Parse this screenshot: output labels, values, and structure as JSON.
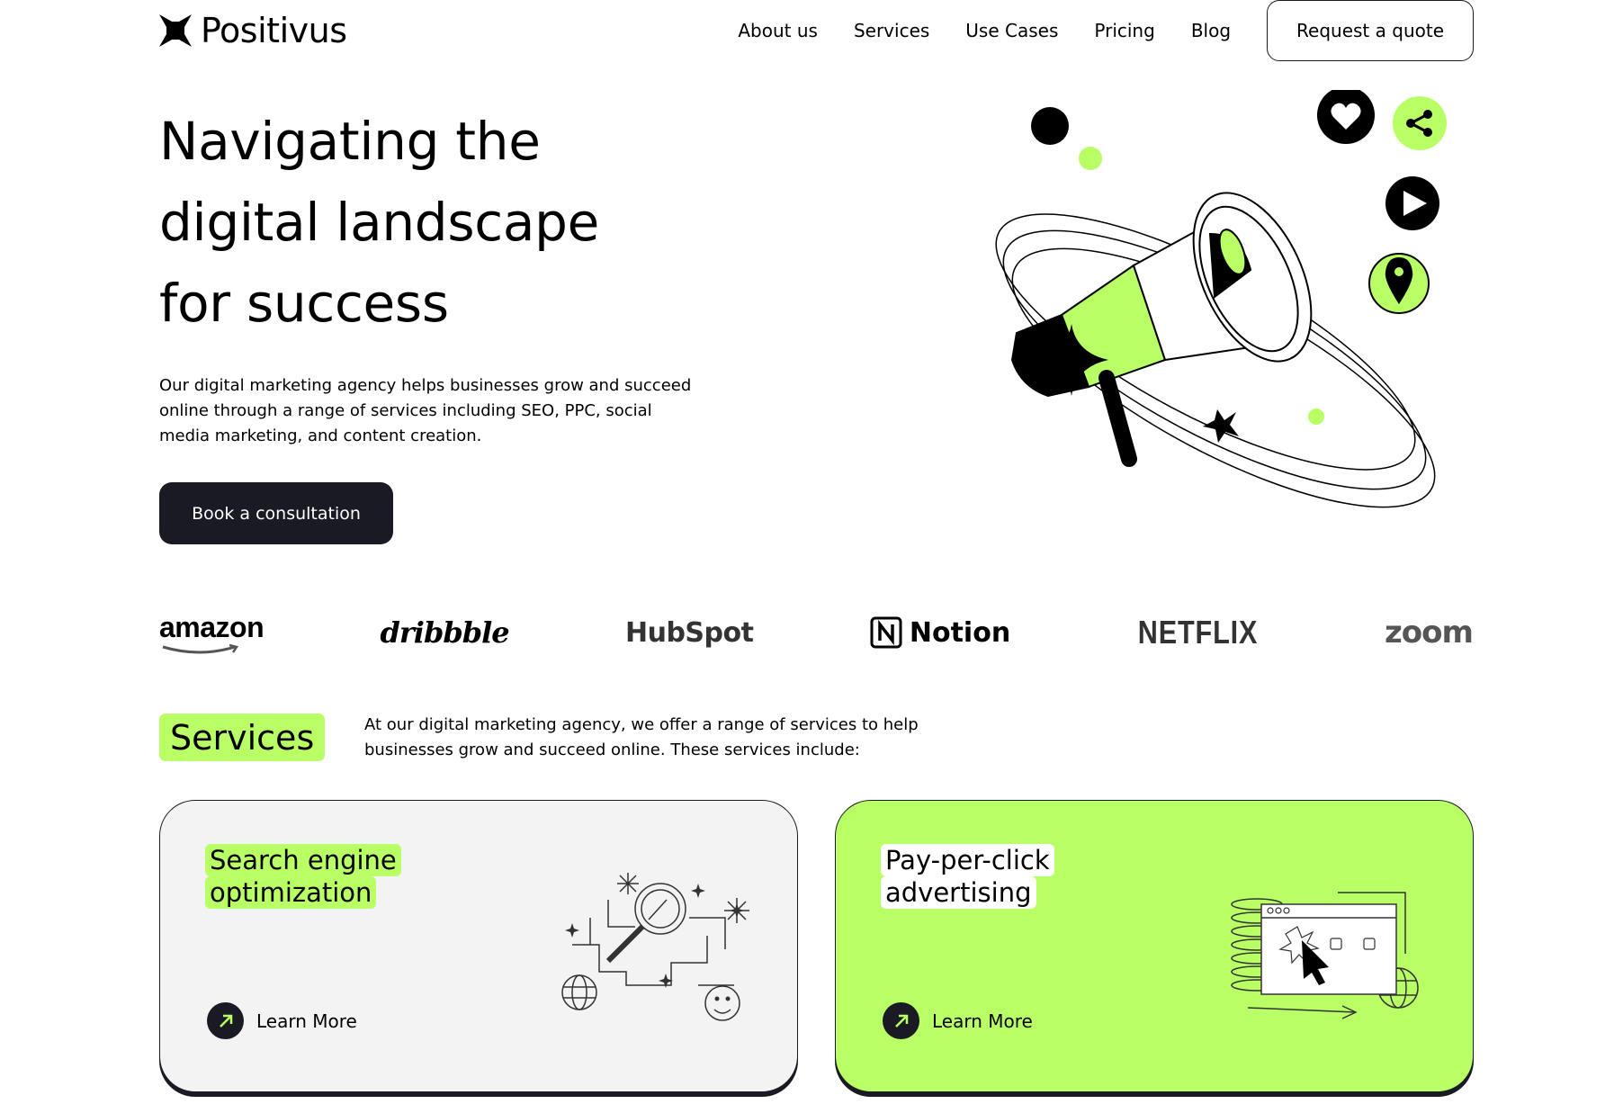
{
  "header": {
    "logo_text": "Positivus",
    "nav": [
      "About us",
      "Services",
      "Use Cases",
      "Pricing",
      "Blog"
    ],
    "quote_button": "Request a quote"
  },
  "hero": {
    "title_lines": [
      "Navigating the",
      "digital landscape",
      "for success"
    ],
    "description": "Our digital marketing agency helps businesses grow and succeed online through a range of services including SEO, PPC, social media marketing, and content creation.",
    "cta": "Book a consultation",
    "illustration": "megaphone-illustration"
  },
  "logos": [
    "amazon",
    "dribbble",
    "HubSpot",
    "Notion",
    "NETFLIX",
    "zoom"
  ],
  "services": {
    "badge": "Services",
    "description": "At our digital marketing agency, we offer a range of services to help businesses grow and succeed online. These services include:",
    "cards": [
      {
        "title_lines": [
          "Search engine",
          "optimization"
        ],
        "link": "Learn More",
        "icon": "seo-magnifier-illustration"
      },
      {
        "title_lines": [
          "Pay-per-click",
          "advertising"
        ],
        "link": "Learn More",
        "icon": "ppc-browser-illustration"
      }
    ]
  },
  "colors": {
    "accent": "#b9ff66",
    "dark": "#191a23",
    "card_gray": "#f3f3f3"
  }
}
